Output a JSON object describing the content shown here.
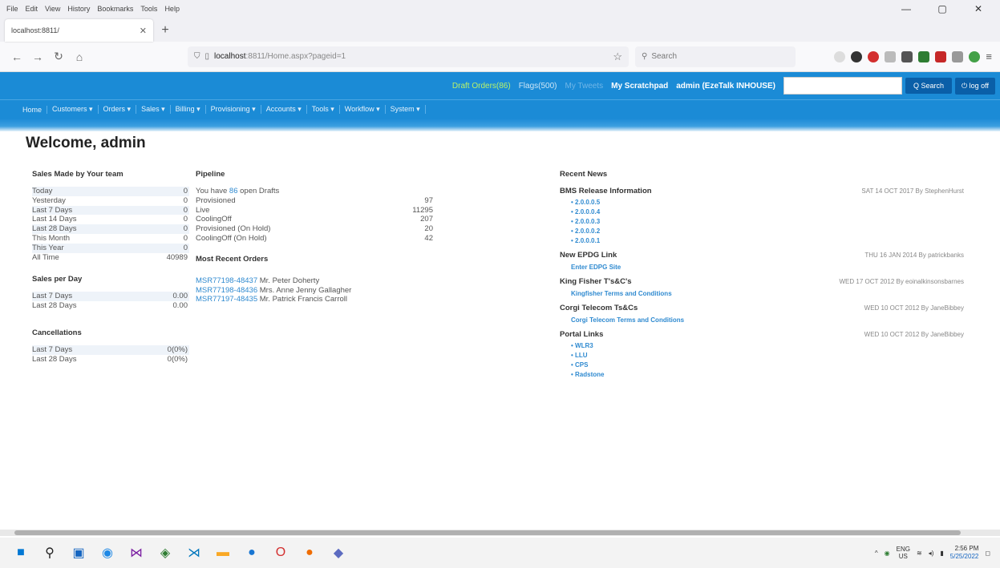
{
  "browser": {
    "menu": [
      "File",
      "Edit",
      "View",
      "History",
      "Bookmarks",
      "Tools",
      "Help"
    ],
    "window_controls": [
      "—",
      "▢",
      "✕"
    ],
    "tab_title": "localhost:8811/",
    "url_host": "localhost",
    "url_rest": ":8811/Home.aspx?pageid=1",
    "search_placeholder": "Search"
  },
  "app": {
    "header_links": {
      "draft": "Draft Orders(86)",
      "flags": "Flags(500)",
      "tweets": "My Tweets",
      "scratchpad": "My Scratchpad",
      "user": "admin (EzeTalk INHOUSE)"
    },
    "search_button": "Q Search",
    "logoff_button": "⏻ log off",
    "nav": [
      "Home",
      "Customers ▾",
      "Orders ▾",
      "Sales ▾",
      "Billing ▾",
      "Provisioning ▾",
      "Accounts ▾",
      "Tools ▾",
      "Workflow ▾",
      "System ▾"
    ]
  },
  "page": {
    "welcome": "Welcome, admin",
    "sales_team": {
      "title": "Sales Made by Your team",
      "rows": [
        {
          "label": "Today",
          "value": "0"
        },
        {
          "label": "Yesterday",
          "value": "0"
        },
        {
          "label": "Last 7 Days",
          "value": "0"
        },
        {
          "label": "Last 14 Days",
          "value": "0"
        },
        {
          "label": "Last 28 Days",
          "value": "0"
        },
        {
          "label": "This Month",
          "value": "0"
        },
        {
          "label": "This Year",
          "value": "0"
        },
        {
          "label": "All Time",
          "value": "40989"
        }
      ]
    },
    "sales_per_day": {
      "title": "Sales per Day",
      "rows": [
        {
          "label": "Last 7 Days",
          "value": "0.00"
        },
        {
          "label": "Last 28 Days",
          "value": "0.00"
        }
      ]
    },
    "cancellations": {
      "title": "Cancellations",
      "rows": [
        {
          "label": "Last 7 Days",
          "value": "0(0%)"
        },
        {
          "label": "Last 28 Days",
          "value": "0(0%)"
        }
      ]
    },
    "pipeline": {
      "title": "Pipeline",
      "drafts_prefix": "You have",
      "drafts_count": "86",
      "drafts_suffix": "open Drafts",
      "rows": [
        {
          "label": "Provisioned",
          "value": "97"
        },
        {
          "label": "Live",
          "value": "11295"
        },
        {
          "label": "CoolingOff",
          "value": "207"
        },
        {
          "label": "Provisioned (On Hold)",
          "value": "20"
        },
        {
          "label": "CoolingOff (On Hold)",
          "value": "42"
        }
      ]
    },
    "recent_orders": {
      "title": "Most Recent Orders",
      "items": [
        {
          "id": "MSR77198-48437",
          "name": "Mr. Peter Doherty"
        },
        {
          "id": "MSR77198-48436",
          "name": "Mrs. Anne Jenny Gallagher"
        },
        {
          "id": "MSR77197-48435",
          "name": "Mr. Patrick Francis Carroll"
        }
      ]
    },
    "news": {
      "title": "Recent News",
      "bms": {
        "title": "BMS Release Information",
        "meta": "SAT 14 OCT 2017 By StephenHurst",
        "items": [
          "2.0.0.0.5",
          "2.0.0.0.4",
          "2.0.0.0.3",
          "2.0.0.0.2",
          "2.0.0.0.1"
        ]
      },
      "epdg": {
        "title": "New EPDG Link",
        "meta": "THU 16 JAN 2014 By patrickbanks",
        "link": "Enter EDPG Site"
      },
      "kingfisher": {
        "title": "King Fisher T's&C's",
        "meta": "WED 17 OCT 2012 By eoinalkinsonsbarnes",
        "link": "Kingfisher Terms and Conditions"
      },
      "corgi": {
        "title": "Corgi Telecom Ts&Cs",
        "meta": "WED 10 OCT 2012 By JaneBibbey",
        "link": "Corgi Telecom Terms and Conditions"
      },
      "portal": {
        "title": "Portal Links",
        "meta": "WED 10 OCT 2012 By JaneBibbey",
        "items": [
          "WLR3",
          "LLU",
          "CPS",
          "Radstone"
        ]
      }
    }
  },
  "taskbar": {
    "lang": "ENG",
    "region": "US",
    "time": "2:56 PM",
    "date": "5/25/2022"
  }
}
